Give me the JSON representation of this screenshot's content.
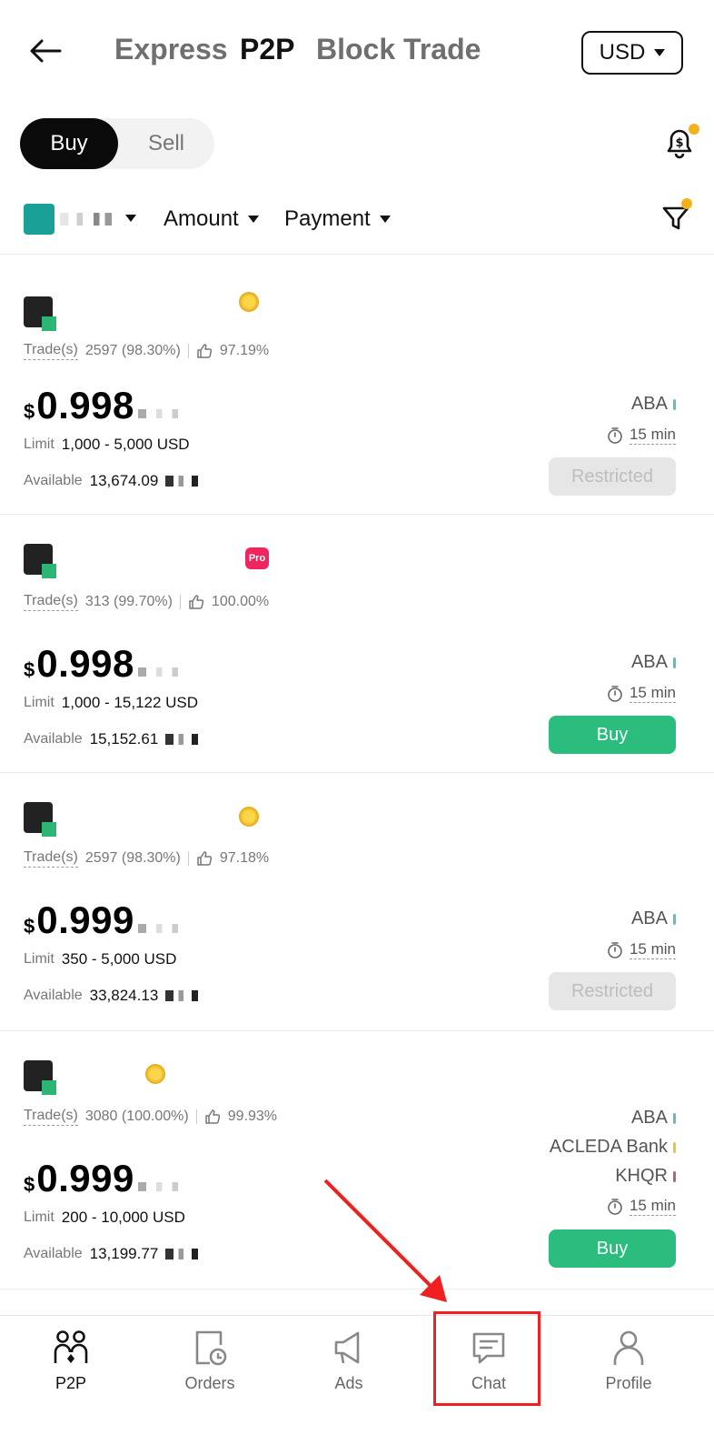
{
  "header": {
    "tabs": [
      "Express",
      "P2P",
      "Block Trade"
    ],
    "active_tab": "P2P",
    "currency": "USD"
  },
  "side_toggle": {
    "buy": "Buy",
    "sell": "Sell",
    "active": "Buy"
  },
  "filters": {
    "amount": "Amount",
    "payment": "Payment"
  },
  "listings": [
    {
      "badge": "gold",
      "trades_label": "Trade(s)",
      "trades": "2597 (98.30%)",
      "rating": "97.19%",
      "currency_symbol": "$",
      "price": "0.998",
      "limit_label": "Limit",
      "limit": "1,000 - 5,000 USD",
      "available_label": "Available",
      "available": "13,674.09",
      "payments": [
        {
          "name": "ABA",
          "color": "#5fbfc0"
        }
      ],
      "time": "15 min",
      "action": "Restricted",
      "action_type": "restricted"
    },
    {
      "badge": "pro",
      "badge_text": "Pro",
      "trades_label": "Trade(s)",
      "trades": "313 (99.70%)",
      "rating": "100.00%",
      "currency_symbol": "$",
      "price": "0.998",
      "limit_label": "Limit",
      "limit": "1,000 - 15,122 USD",
      "available_label": "Available",
      "available": "15,152.61",
      "payments": [
        {
          "name": "ABA",
          "color": "#5fbfc0"
        }
      ],
      "time": "15 min",
      "action": "Buy",
      "action_type": "buy"
    },
    {
      "badge": "gold",
      "trades_label": "Trade(s)",
      "trades": "2597 (98.30%)",
      "rating": "97.18%",
      "currency_symbol": "$",
      "price": "0.999",
      "limit_label": "Limit",
      "limit": "350 - 5,000 USD",
      "available_label": "Available",
      "available": "33,824.13",
      "payments": [
        {
          "name": "ABA",
          "color": "#5fbfc0"
        }
      ],
      "time": "15 min",
      "action": "Restricted",
      "action_type": "restricted"
    },
    {
      "badge": "gold",
      "trades_label": "Trade(s)",
      "trades": "3080 (100.00%)",
      "rating": "99.93%",
      "currency_symbol": "$",
      "price": "0.999",
      "limit_label": "Limit",
      "limit": "200 - 10,000 USD",
      "available_label": "Available",
      "available": "13,199.77",
      "payments": [
        {
          "name": "ABA",
          "color": "#5fbfc0"
        },
        {
          "name": "ACLEDA Bank",
          "color": "#f0c23a"
        },
        {
          "name": "KHQR",
          "color": "#c0606a"
        }
      ],
      "time": "15 min",
      "action": "Buy",
      "action_type": "buy"
    }
  ],
  "bottom_nav": [
    {
      "label": "P2P",
      "icon": "p2p-icon",
      "active": true
    },
    {
      "label": "Orders",
      "icon": "orders-icon",
      "active": false
    },
    {
      "label": "Ads",
      "icon": "megaphone-icon",
      "active": false
    },
    {
      "label": "Chat",
      "icon": "chat-icon",
      "active": false
    },
    {
      "label": "Profile",
      "icon": "profile-icon",
      "active": false
    }
  ],
  "colors": {
    "accent_green": "#2bbd7e",
    "notice_dot": "#f3b21b",
    "annotation_red": "#f02020"
  }
}
